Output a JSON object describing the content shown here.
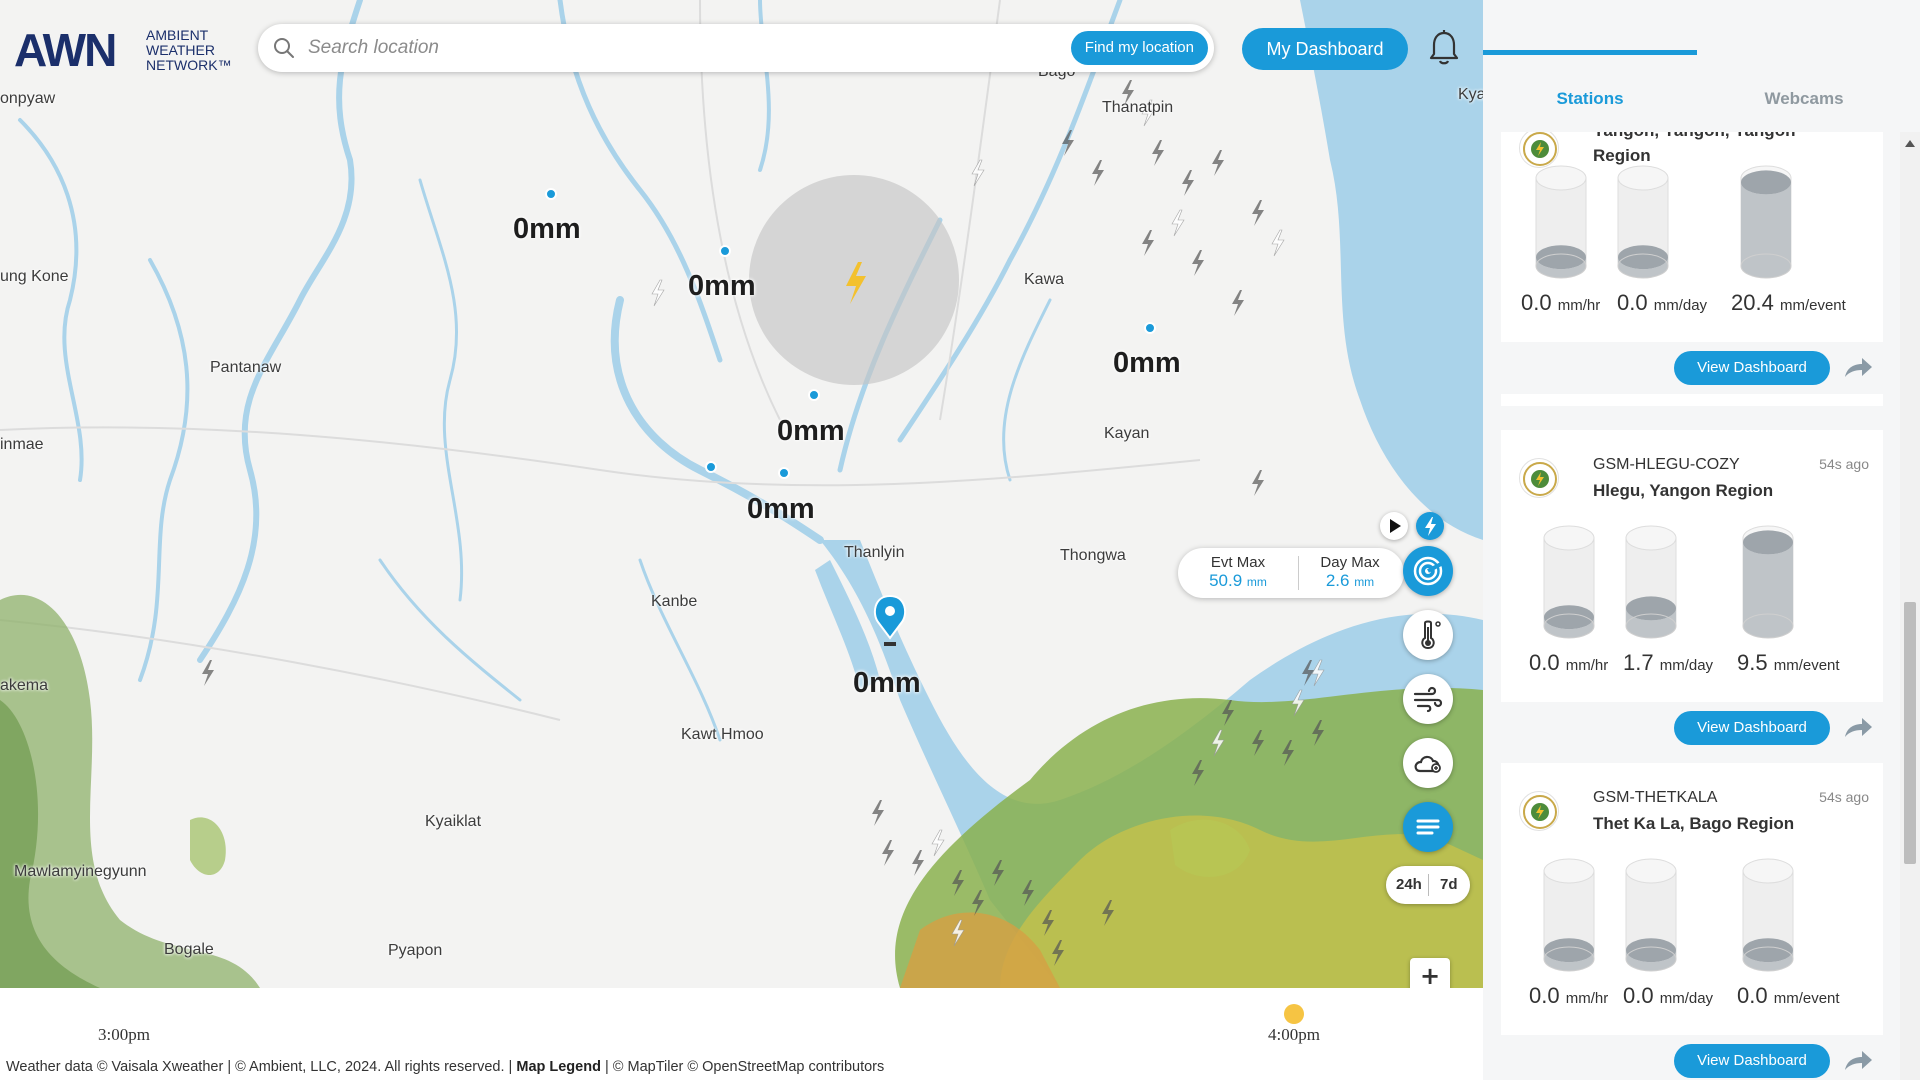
{
  "header": {
    "logo_main": "AWN",
    "logo_sub_1": "AMBIENT",
    "logo_sub_2": "WEATHER",
    "logo_sub_3": "NETWORK™",
    "search_placeholder": "Search location",
    "find_location_label": "Find my location",
    "dashboard_label": "My Dashboard"
  },
  "map": {
    "places": [
      {
        "name": "onpyaw"
      },
      {
        "name": "ung Kone"
      },
      {
        "name": "Pantanaw"
      },
      {
        "name": "inmae"
      },
      {
        "name": "akema"
      },
      {
        "name": "Mawlamyinegyunn"
      },
      {
        "name": "Bogale"
      },
      {
        "name": "Pyapon"
      },
      {
        "name": "Kyaiklat"
      },
      {
        "name": "Kawt Hmoo"
      },
      {
        "name": "Kanbe"
      },
      {
        "name": "Thanlyin"
      },
      {
        "name": "Thongwa"
      },
      {
        "name": "Kayan"
      },
      {
        "name": "Kawa"
      },
      {
        "name": "Thanatpin"
      },
      {
        "name": "Bago"
      },
      {
        "name": "Kya"
      }
    ],
    "rain_labels": [
      "0mm",
      "0mm",
      "0mm",
      "0mm",
      "0mm",
      "0mm"
    ],
    "max_box": {
      "evt_label": "Evt Max",
      "evt_value": "50.9",
      "evt_unit": "mm",
      "day_label": "Day Max",
      "day_value": "2.6",
      "day_unit": "mm"
    },
    "range": {
      "short": "24h",
      "long": "7d"
    },
    "zoom": {
      "in": "+",
      "out": "−"
    },
    "colors": {
      "accent": "#1a9ad9",
      "water": "#aad3ea"
    }
  },
  "timeline": {
    "start_time": "3:00pm",
    "end_time": "4:00pm"
  },
  "footer": {
    "part1": "Weather data © Vaisala Xweather | © Ambient, LLC, 2024. All rights reserved. |",
    "legend": "Map Legend",
    "part2": "| © MapTiler © OpenStreetMap contributors"
  },
  "sidebar": {
    "tabs": [
      {
        "label": "Stations",
        "active": true
      },
      {
        "label": "Webcams",
        "active": false
      }
    ],
    "stations": [
      {
        "name": "",
        "location": "Yangon, Yangon, Yangon Region",
        "ago": "",
        "metrics": [
          {
            "value": "0.0",
            "unit": "mm/hr",
            "level": 0.1
          },
          {
            "value": "0.0",
            "unit": "mm/day",
            "level": 0.1
          },
          {
            "value": "20.4",
            "unit": "mm/event",
            "level": 0.95
          }
        ],
        "button": "View Dashboard"
      },
      {
        "name": "GSM-HLEGU-COZY",
        "location": "Hlegu, Yangon Region",
        "ago": "54s ago",
        "metrics": [
          {
            "value": "0.0",
            "unit": "mm/hr",
            "level": 0.1
          },
          {
            "value": "1.7",
            "unit": "mm/day",
            "level": 0.2
          },
          {
            "value": "9.5",
            "unit": "mm/event",
            "level": 0.95
          }
        ],
        "button": "View Dashboard"
      },
      {
        "name": "GSM-THETKALA",
        "location": "Thet Ka La, Bago Region",
        "ago": "54s ago",
        "metrics": [
          {
            "value": "0.0",
            "unit": "mm/hr",
            "level": 0.1
          },
          {
            "value": "0.0",
            "unit": "mm/day",
            "level": 0.1
          },
          {
            "value": "0.0",
            "unit": "mm/event",
            "level": 0.1
          }
        ],
        "button": "View Dashboard"
      }
    ]
  }
}
